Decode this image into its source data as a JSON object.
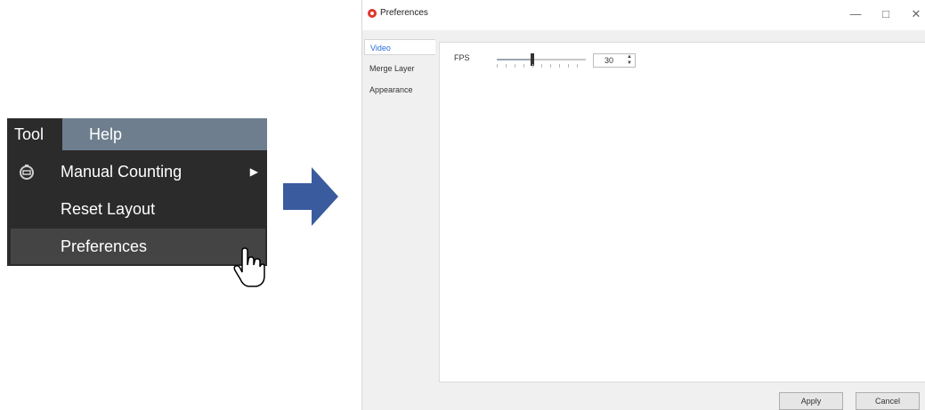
{
  "menu": {
    "menubar": {
      "tool": "Tool",
      "help": "Help"
    },
    "items": [
      {
        "label": "Manual Counting",
        "has_submenu": true,
        "icon": "counter-icon"
      },
      {
        "label": "Reset Layout"
      },
      {
        "label": "Preferences",
        "hovered": true
      }
    ]
  },
  "dialog": {
    "title": "Preferences",
    "nav": [
      "Video",
      "Merge Layer",
      "Appearance"
    ],
    "active_nav": "Video",
    "fps": {
      "label": "FPS",
      "value": "30",
      "slider_fraction": 0.4
    },
    "buttons": {
      "apply": "Apply",
      "cancel": "Cancel"
    },
    "window_controls": {
      "minimize": "—",
      "maximize": "□",
      "close": "✕"
    }
  },
  "colors": {
    "menu_bg": "#2b2b2b",
    "menubar_bg": "#6e7e8e",
    "arrow": "#3a5c9e",
    "logo": "#e0352b",
    "active_tab_text": "#2a6fd6"
  }
}
